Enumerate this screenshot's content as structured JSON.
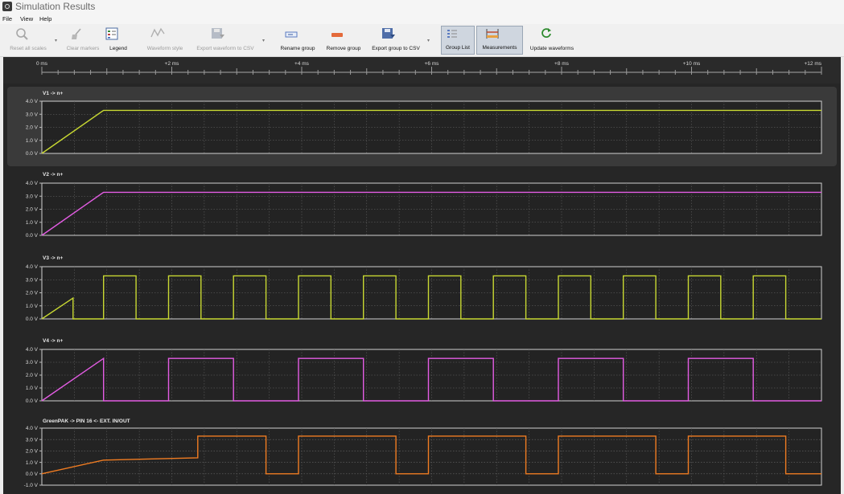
{
  "window": {
    "title": "Simulation Results"
  },
  "menu": [
    "File",
    "View",
    "Help"
  ],
  "toolbar": {
    "reset_all_scales": "Reset all scales",
    "clear_markers": "Clear markers",
    "legend": "Legend",
    "waveform_style": "Waveform style",
    "export_waveform_csv": "Export waveform to CSV",
    "rename_group": "Rename group",
    "remove_group": "Remove group",
    "export_group_csv": "Export group to CSV",
    "group_list": "Group List",
    "measurements": "Measurements",
    "update_waveforms": "Update waveforms"
  },
  "time_axis": {
    "labels": [
      "0 ms",
      "+2 ms",
      "+4 ms",
      "+6 ms",
      "+8 ms",
      "+10 ms",
      "+12 ms"
    ],
    "range_ms": [
      0,
      12
    ]
  },
  "colors": {
    "yellow": "#c8d832",
    "magenta": "#e35ce3",
    "orange": "#f07c22"
  },
  "chart_data": [
    {
      "type": "line",
      "title": "V1 -> n+",
      "ylim": [
        0,
        4
      ],
      "yticks": [
        "4.0 V",
        "3.0 V",
        "2.0 V",
        "1.0 V",
        "0.0 V"
      ],
      "series": [
        {
          "color": "#c8d832",
          "x": [
            0,
            0.95,
            12
          ],
          "y": [
            0,
            3.3,
            3.3
          ]
        }
      ]
    },
    {
      "type": "line",
      "title": "V2 -> n+",
      "ylim": [
        0,
        4
      ],
      "yticks": [
        "4.0 V",
        "3.0 V",
        "2.0 V",
        "1.0 V",
        "0.0 V"
      ],
      "series": [
        {
          "color": "#e35ce3",
          "x": [
            0,
            0.95,
            12
          ],
          "y": [
            0,
            3.3,
            3.3
          ]
        }
      ]
    },
    {
      "type": "line",
      "title": "V3 -> n+",
      "ylim": [
        0,
        4
      ],
      "yticks": [
        "4.0 V",
        "3.0 V",
        "2.0 V",
        "1.0 V",
        "0.0 V"
      ],
      "series": [
        {
          "color": "#c8d832",
          "x": [
            0,
            0.48,
            0.48,
            0.95,
            0.95,
            1.45,
            1.45,
            1.95,
            1.95,
            2.45,
            2.45,
            2.95,
            2.95,
            3.45,
            3.45,
            3.95,
            3.95,
            4.45,
            4.45,
            4.95,
            4.95,
            5.45,
            5.45,
            5.95,
            5.95,
            6.45,
            6.45,
            6.95,
            6.95,
            7.45,
            7.45,
            7.95,
            7.95,
            8.45,
            8.45,
            8.95,
            8.95,
            9.45,
            9.45,
            9.95,
            9.95,
            10.45,
            10.45,
            10.95,
            10.95,
            11.45,
            11.45,
            12
          ],
          "y": [
            0,
            1.6,
            0,
            0,
            3.3,
            3.3,
            0,
            0,
            3.3,
            3.3,
            0,
            0,
            3.3,
            3.3,
            0,
            0,
            3.3,
            3.3,
            0,
            0,
            3.3,
            3.3,
            0,
            0,
            3.3,
            3.3,
            0,
            0,
            3.3,
            3.3,
            0,
            0,
            3.3,
            3.3,
            0,
            0,
            3.3,
            3.3,
            0,
            0,
            3.3,
            3.3,
            0,
            0,
            3.3,
            3.3,
            0,
            0
          ]
        }
      ]
    },
    {
      "type": "line",
      "title": "V4 -> n+",
      "ylim": [
        0,
        4
      ],
      "yticks": [
        "4.0 V",
        "3.0 V",
        "2.0 V",
        "1.0 V",
        "0.0 V"
      ],
      "series": [
        {
          "color": "#e35ce3",
          "x": [
            0,
            0.95,
            0.95,
            1.95,
            1.95,
            2.95,
            2.95,
            3.95,
            3.95,
            4.95,
            4.95,
            5.95,
            5.95,
            6.95,
            6.95,
            7.95,
            7.95,
            8.95,
            8.95,
            9.95,
            9.95,
            10.95,
            10.95,
            12
          ],
          "y": [
            0,
            3.3,
            0,
            0,
            3.3,
            3.3,
            0,
            0,
            3.3,
            3.3,
            0,
            0,
            3.3,
            3.3,
            0,
            0,
            3.3,
            3.3,
            0,
            0,
            3.3,
            3.3,
            0,
            0
          ]
        }
      ]
    },
    {
      "type": "line",
      "title": "GreenPAK -> PIN 16 <- EXT. IN/OUT",
      "ylim": [
        -1,
        4
      ],
      "yticks": [
        "4.0 V",
        "3.0 V",
        "2.0 V",
        "1.0 V",
        "0.0 V",
        "-1.0 V"
      ],
      "series": [
        {
          "color": "#f07c22",
          "x": [
            0,
            0.95,
            2.4,
            2.4,
            3.45,
            3.45,
            3.95,
            3.95,
            5.45,
            5.45,
            5.95,
            5.95,
            7.45,
            7.45,
            7.95,
            7.95,
            9.45,
            9.45,
            9.95,
            9.95,
            11.45,
            11.45,
            12
          ],
          "y": [
            0,
            1.2,
            1.4,
            3.3,
            3.3,
            0,
            0,
            3.3,
            3.3,
            0,
            0,
            3.3,
            3.3,
            0,
            0,
            3.3,
            3.3,
            0,
            0,
            3.3,
            3.3,
            0,
            0
          ]
        }
      ]
    }
  ]
}
